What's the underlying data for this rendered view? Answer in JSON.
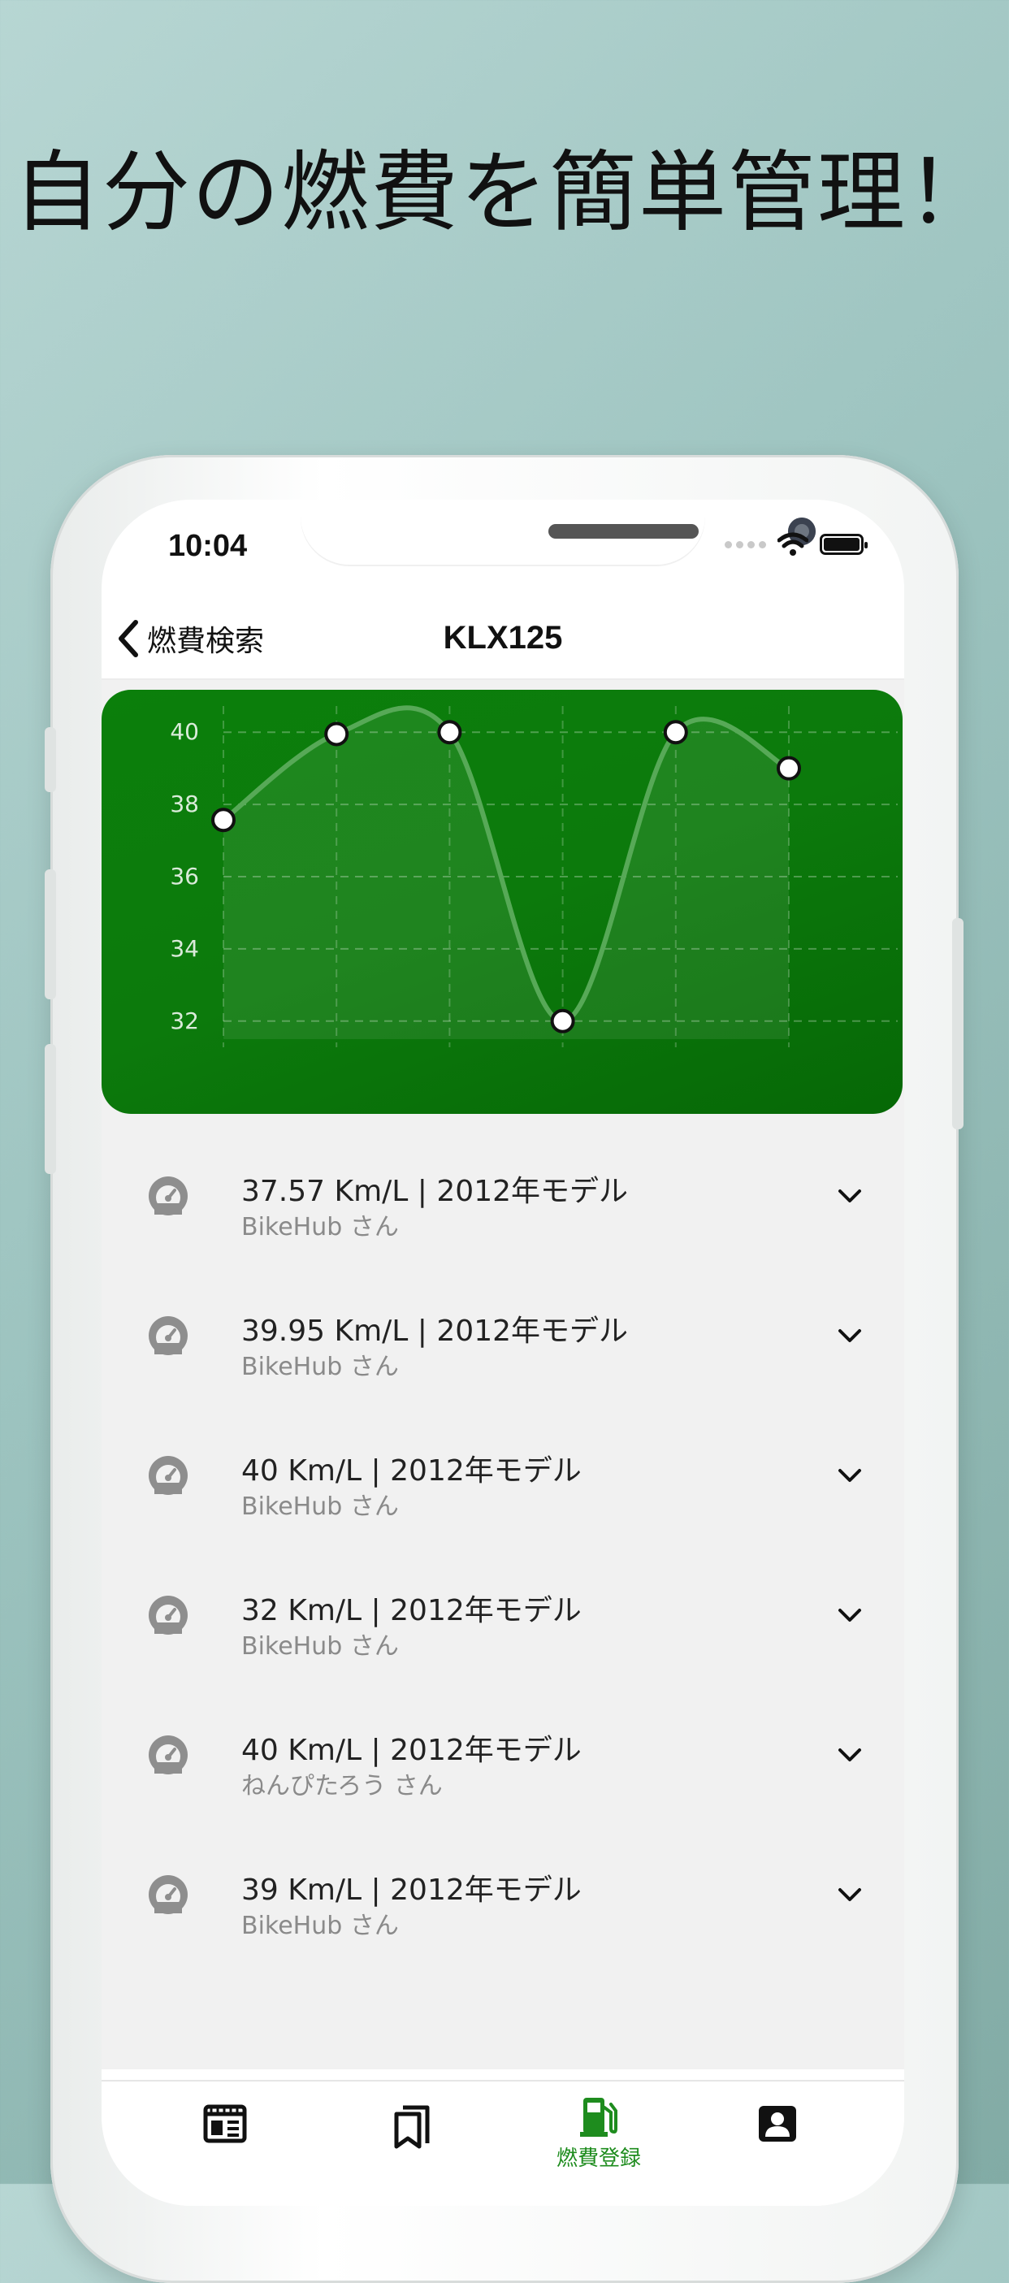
{
  "headline": "自分の燃費を簡単管理！",
  "status_bar": {
    "time": "10:04"
  },
  "nav": {
    "back_label": "燃費検索",
    "title": "KLX125"
  },
  "chart_data": {
    "type": "line",
    "x": [
      1,
      2,
      3,
      4,
      5,
      6
    ],
    "values": [
      37.57,
      39.95,
      40,
      32,
      40,
      39
    ],
    "ylim": [
      31.5,
      40.5
    ],
    "y_ticks": [
      "40",
      "38",
      "36",
      "34",
      "32"
    ],
    "grid": true,
    "colors": {
      "background": "#0a7a0a",
      "line": "#57a957",
      "point": "#ffffff"
    }
  },
  "records": [
    {
      "title": "37.57 Km/L | 2012年モデル",
      "user": "BikeHub さん"
    },
    {
      "title": "39.95 Km/L | 2012年モデル",
      "user": "BikeHub さん"
    },
    {
      "title": "40 Km/L | 2012年モデル",
      "user": "BikeHub さん"
    },
    {
      "title": "32 Km/L | 2012年モデル",
      "user": "BikeHub さん"
    },
    {
      "title": "40 Km/L | 2012年モデル",
      "user": "ねんぴたろう さん"
    },
    {
      "title": "39 Km/L | 2012年モデル",
      "user": "BikeHub さん"
    }
  ],
  "tabbar": {
    "active_color": "#1e8c1e",
    "items": [
      {
        "icon": "news-icon"
      },
      {
        "icon": "bookmarks-icon"
      },
      {
        "icon": "fuel-pump-icon",
        "label": "燃費登録"
      },
      {
        "icon": "contact-card-icon"
      }
    ]
  }
}
